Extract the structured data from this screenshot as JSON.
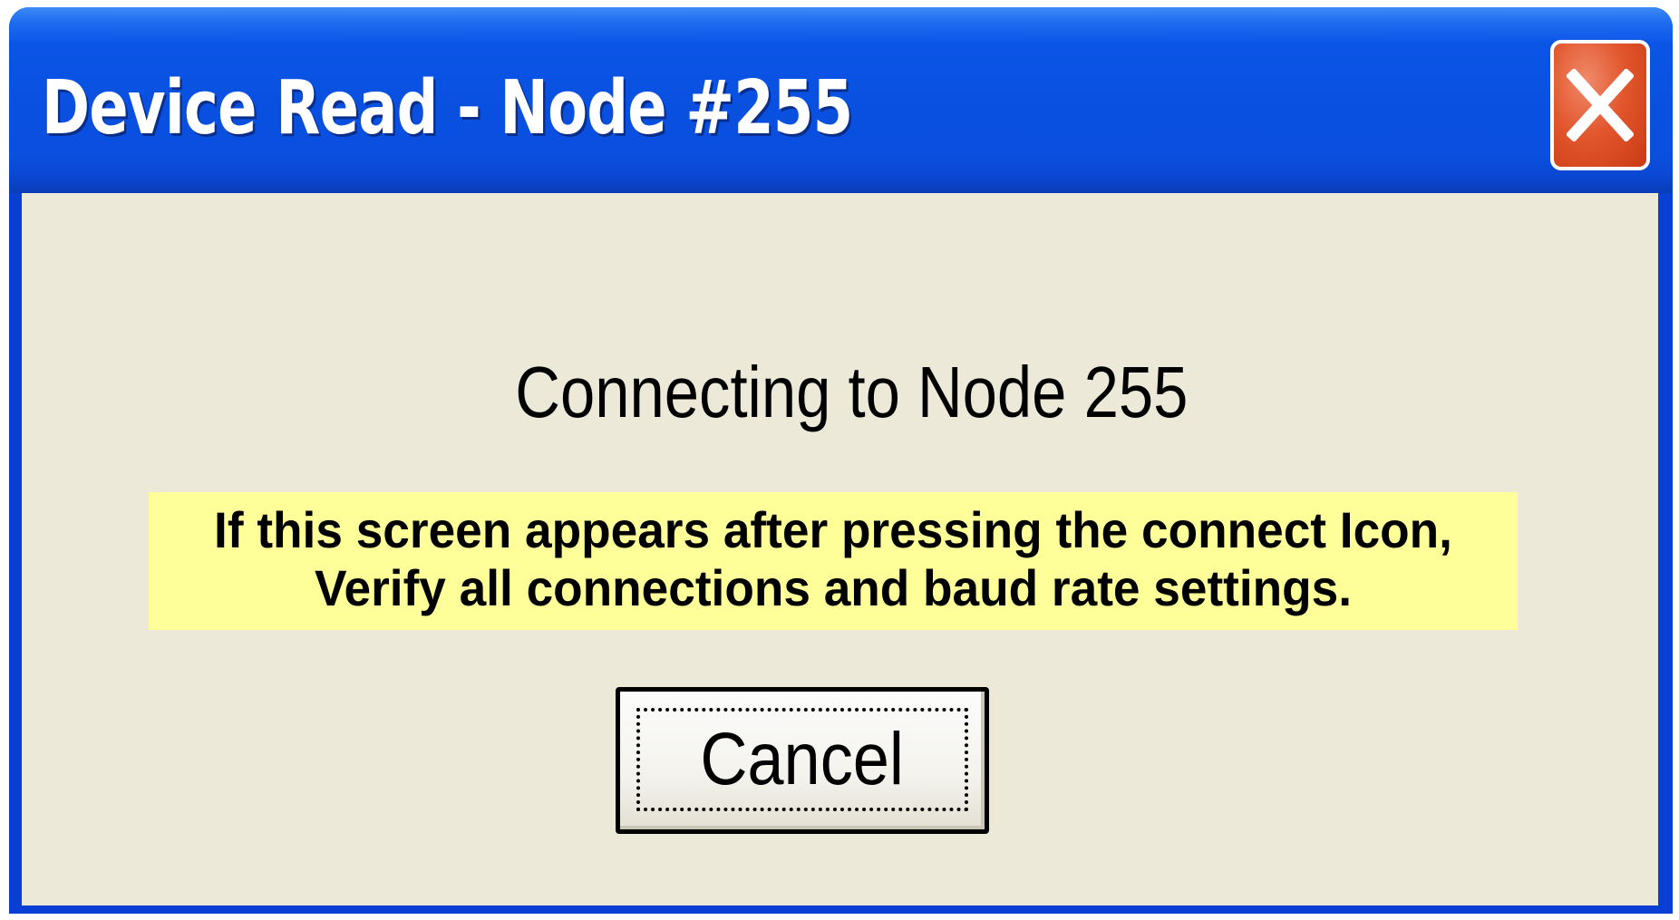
{
  "window": {
    "title": "Device Read - Node #255",
    "close_icon": "close-x-icon",
    "titlebar_color": "#0a50e0",
    "client_color": "#ece9d8"
  },
  "dialog": {
    "status": "Connecting to Node 255",
    "notice": {
      "line1": "If this screen appears after pressing the connect Icon,",
      "line2": "Verify all connections and baud rate settings.",
      "background_color": "#ffff99"
    },
    "cancel_label": "Cancel"
  }
}
